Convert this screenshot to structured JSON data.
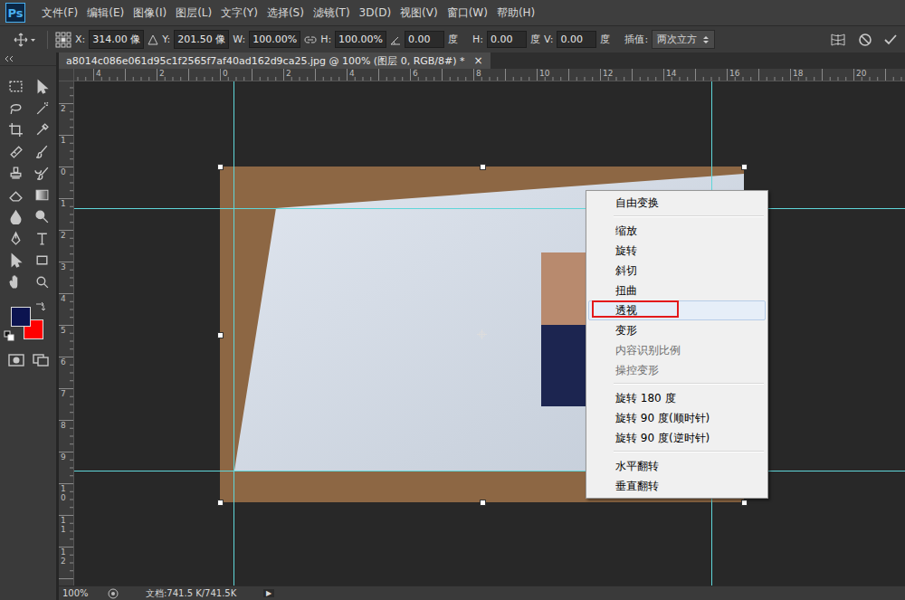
{
  "app": {
    "logo": "Ps"
  },
  "menu_bar": [
    "文件(F)",
    "编辑(E)",
    "图像(I)",
    "图层(L)",
    "文字(Y)",
    "选择(S)",
    "滤镜(T)",
    "3D(D)",
    "视图(V)",
    "窗口(W)",
    "帮助(H)"
  ],
  "options_bar": {
    "x_label": "X:",
    "x_value": "314.00 像",
    "y_label": "Y:",
    "y_value": "201.50 像",
    "w_label": "W:",
    "w_value": "100.00%",
    "h_label": "H:",
    "h_value": "100.00%",
    "angle_value": "0.00",
    "angle_unit": "度",
    "hskew_label": "H:",
    "hskew_value": "0.00",
    "hskew_unit": "度",
    "vskew_label": "V:",
    "vskew_value": "0.00",
    "vskew_unit": "度",
    "interpolation_label": "插值:",
    "interpolation_value": "两次立方"
  },
  "document_tab": {
    "title": "a8014c086e061d95c1f2565f7af40ad162d9ca25.jpg @ 100% (图层 0, RGB/8#) *",
    "close": "×",
    "selected": true
  },
  "rulers": {
    "horizontal": [
      "4",
      "2",
      "0",
      "2",
      "4",
      "6",
      "8",
      "10",
      "12",
      "14",
      "16",
      "18",
      "20"
    ],
    "vertical": [
      "2",
      "1",
      "0",
      "1",
      "2",
      "3",
      "4",
      "5",
      "6",
      "7",
      "8",
      "9",
      "10",
      "11",
      "12"
    ]
  },
  "toolbar": {
    "foreground_color": "#0c1450",
    "background_color": "#ff0000"
  },
  "context_menu": {
    "groups": [
      [
        {
          "label": "自由变换",
          "disabled": false,
          "selected": false,
          "marked": false
        }
      ],
      [
        {
          "label": "缩放",
          "disabled": false,
          "selected": false,
          "marked": false
        },
        {
          "label": "旋转",
          "disabled": false,
          "selected": false,
          "marked": false
        },
        {
          "label": "斜切",
          "disabled": false,
          "selected": false,
          "marked": false
        },
        {
          "label": "扭曲",
          "disabled": false,
          "selected": false,
          "marked": false
        },
        {
          "label": "透视",
          "disabled": false,
          "selected": true,
          "marked": true
        },
        {
          "label": "变形",
          "disabled": false,
          "selected": false,
          "marked": false
        },
        {
          "label": "内容识别比例",
          "disabled": true,
          "selected": false,
          "marked": false
        },
        {
          "label": "操控变形",
          "disabled": true,
          "selected": false,
          "marked": false
        }
      ],
      [
        {
          "label": "旋转 180 度",
          "disabled": false,
          "selected": false,
          "marked": false
        },
        {
          "label": "旋转 90 度(顺时针)",
          "disabled": false,
          "selected": false,
          "marked": false
        },
        {
          "label": "旋转 90 度(逆时针)",
          "disabled": false,
          "selected": false,
          "marked": false
        }
      ],
      [
        {
          "label": "水平翻转",
          "disabled": false,
          "selected": false,
          "marked": false
        },
        {
          "label": "垂直翻转",
          "disabled": false,
          "selected": false,
          "marked": false
        }
      ]
    ]
  },
  "status_bar": {
    "zoom": "100%",
    "document": "文档:741.5 K/741.5K",
    "arrow": "▶"
  }
}
